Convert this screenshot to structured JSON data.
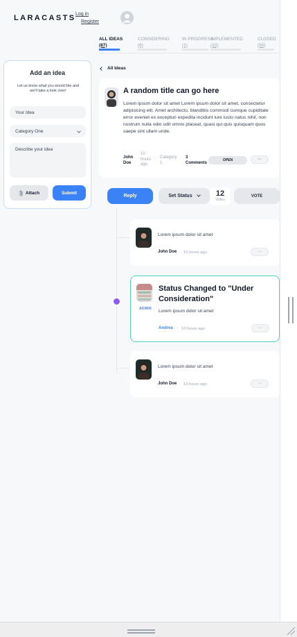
{
  "header": {
    "logo_text": "LARACASTS",
    "login_label": "Log in",
    "register_label": "Register"
  },
  "tabs": [
    {
      "label": "ALL IDEAS",
      "count": "(87)"
    },
    {
      "label": "CONSIDERING",
      "count": "(6)"
    },
    {
      "label": "IN PROGRESS",
      "count": "(1)"
    },
    {
      "label": "IMPLEMENTED",
      "count": "(10)"
    },
    {
      "label": "CLOSED",
      "count": "(55)"
    }
  ],
  "add_idea": {
    "title": "Add an idea",
    "subtitle": "Let us know what you would like and we'll take a look over!",
    "title_placeholder": "Your Idea",
    "category_value": "Category One",
    "description_placeholder": "Describe your idea",
    "attach_label": "Attach",
    "submit_label": "Submit"
  },
  "back_link": "All Ideas",
  "idea": {
    "title": "A random title can go here",
    "description": "Lorem ipsum dolor sit amet Lorem ipsum dolor sit amet, consectetur adipisicing elit. Amet architecto, blanditiis commodi cumque cupiditate error eveniet ex excepturi expedita incidunt iure iusto natus nihil, non nostrum nulla odio odit omnis placeat, quasi qui quis quisquam quos saepe sint ullam unde.",
    "author_first": "John",
    "author_last": "Doe",
    "time_1": "10",
    "time_2": "hours",
    "time_3": "ago",
    "category_1": "Category",
    "category_2": "1",
    "comments_1": "3",
    "comments_2": "Comments",
    "status": "OPEN",
    "more_label": "···"
  },
  "actions": {
    "reply_label": "Reply",
    "set_status_label": "Set Status",
    "votes_count": "12",
    "votes_label": "Votes",
    "vote_label": "VOTE"
  },
  "comments": [
    {
      "body": "Lorem ipsum dolor sit amet",
      "author": "John Doe",
      "separator": "·",
      "time": "10 hours ago",
      "more": "···"
    },
    {
      "title": "Status Changed to \"Under Consideration\"",
      "body": "Lorem ipsum dolor sit amet",
      "author": "Andrea",
      "separator": "·",
      "time": "10 hours ago",
      "badge": "ADMIN",
      "more": "···"
    },
    {
      "body": "Lorem ipsum dolor sit amet",
      "author": "John Doe",
      "separator": "·",
      "time": "10 hours ago",
      "more": "···"
    }
  ],
  "colors": {
    "accent": "#3b82f6",
    "timeline_dot": "#8b5cf6",
    "status_border": "#4fd1c5"
  },
  "icons": [
    "user-avatar-icon",
    "chevron-left-icon",
    "chevron-down-icon",
    "paperclip-icon"
  ]
}
